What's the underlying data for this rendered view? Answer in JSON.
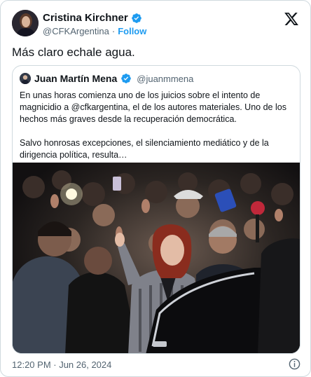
{
  "author": {
    "display_name": "Cristina Kirchner",
    "handle": "@CFKArgentina",
    "separator": "·",
    "follow_label": "Follow",
    "verified_icon": "verified-badge-icon"
  },
  "tweet": {
    "text": "Más claro echale agua.",
    "timestamp": "12:20 PM · Jun 26, 2024"
  },
  "quoted": {
    "display_name": "Juan Martín Mena",
    "handle": "@juanmmena",
    "paragraph_1": "En unas horas comienza uno de los juicios sobre el intento de magnicidio a @cfkargentina, el de los autores materiales. Uno de los hechos más graves desde la recuperación democrática.",
    "paragraph_2": "Salvo honrosas excepciones, el silenciamiento mediático y de la dirigencia política, resulta…"
  },
  "icons": {
    "platform": "x-logo-icon",
    "info": "info-icon"
  },
  "colors": {
    "link": "#1d9bf0",
    "secondary_text": "#536471",
    "border": "#cfd9de"
  }
}
